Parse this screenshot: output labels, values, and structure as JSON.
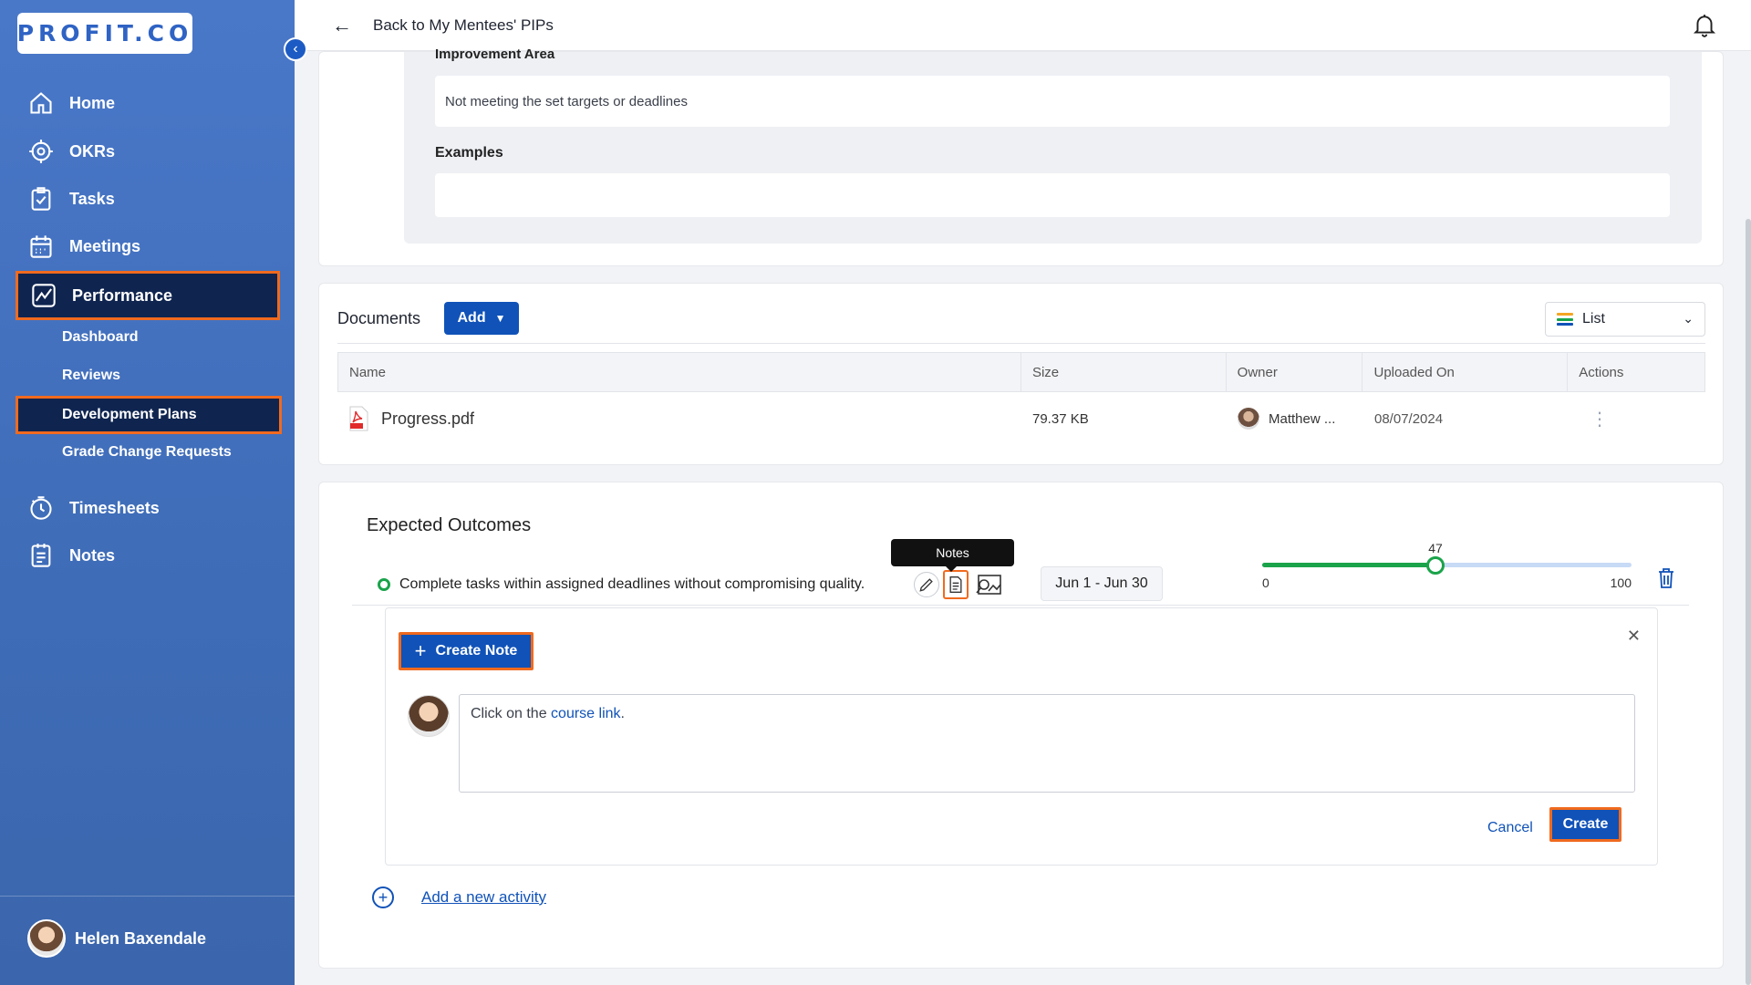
{
  "sidebar": {
    "logo": "PROFIT.CO",
    "items": [
      {
        "label": "Home",
        "icon": "home-icon"
      },
      {
        "label": "OKRs",
        "icon": "target-icon"
      },
      {
        "label": "Tasks",
        "icon": "clipboard-check-icon"
      },
      {
        "label": "Meetings",
        "icon": "calendar-icon"
      },
      {
        "label": "Performance",
        "icon": "chart-line-icon"
      },
      {
        "label": "Timesheets",
        "icon": "stopwatch-icon"
      },
      {
        "label": "Notes",
        "icon": "notes-icon"
      }
    ],
    "sub_items": [
      "Dashboard",
      "Reviews",
      "Development Plans",
      "Grade Change Requests"
    ],
    "user_name": "Helen Baxendale"
  },
  "topbar": {
    "back_title": "Back to My Mentees' PIPs"
  },
  "improvement": {
    "area_label": "Improvement Area",
    "area_value": "Not meeting the set targets or deadlines",
    "examples_label": "Examples",
    "examples_value": ""
  },
  "documents": {
    "title": "Documents",
    "add_label": "Add",
    "view_label": "List",
    "columns": [
      "Name",
      "Size",
      "Owner",
      "Uploaded On",
      "Actions"
    ],
    "rows": [
      {
        "name": "Progress.pdf",
        "size": "79.37 KB",
        "owner": "Matthew ...",
        "uploaded": "08/07/2024"
      }
    ]
  },
  "outcomes": {
    "title": "Expected Outcomes",
    "item": {
      "text": "Complete tasks within assigned deadlines without compromising quality.",
      "date_range": "Jun 1 - Jun 30",
      "progress": 47,
      "min": "0",
      "max": "100",
      "progress_label": "47"
    },
    "tooltip": "Notes",
    "notes_panel": {
      "create_note_label": "Create Note",
      "editor_prefix": "Click on the ",
      "editor_link": "course link",
      "editor_suffix": ".",
      "cancel_label": "Cancel",
      "create_label": "Create"
    },
    "add_activity_label": "Add a new activity"
  },
  "colors": {
    "accent": "#1052b8",
    "highlight": "#f06a1e",
    "success": "#1aa34a",
    "sidebar": "#4a78c9"
  }
}
